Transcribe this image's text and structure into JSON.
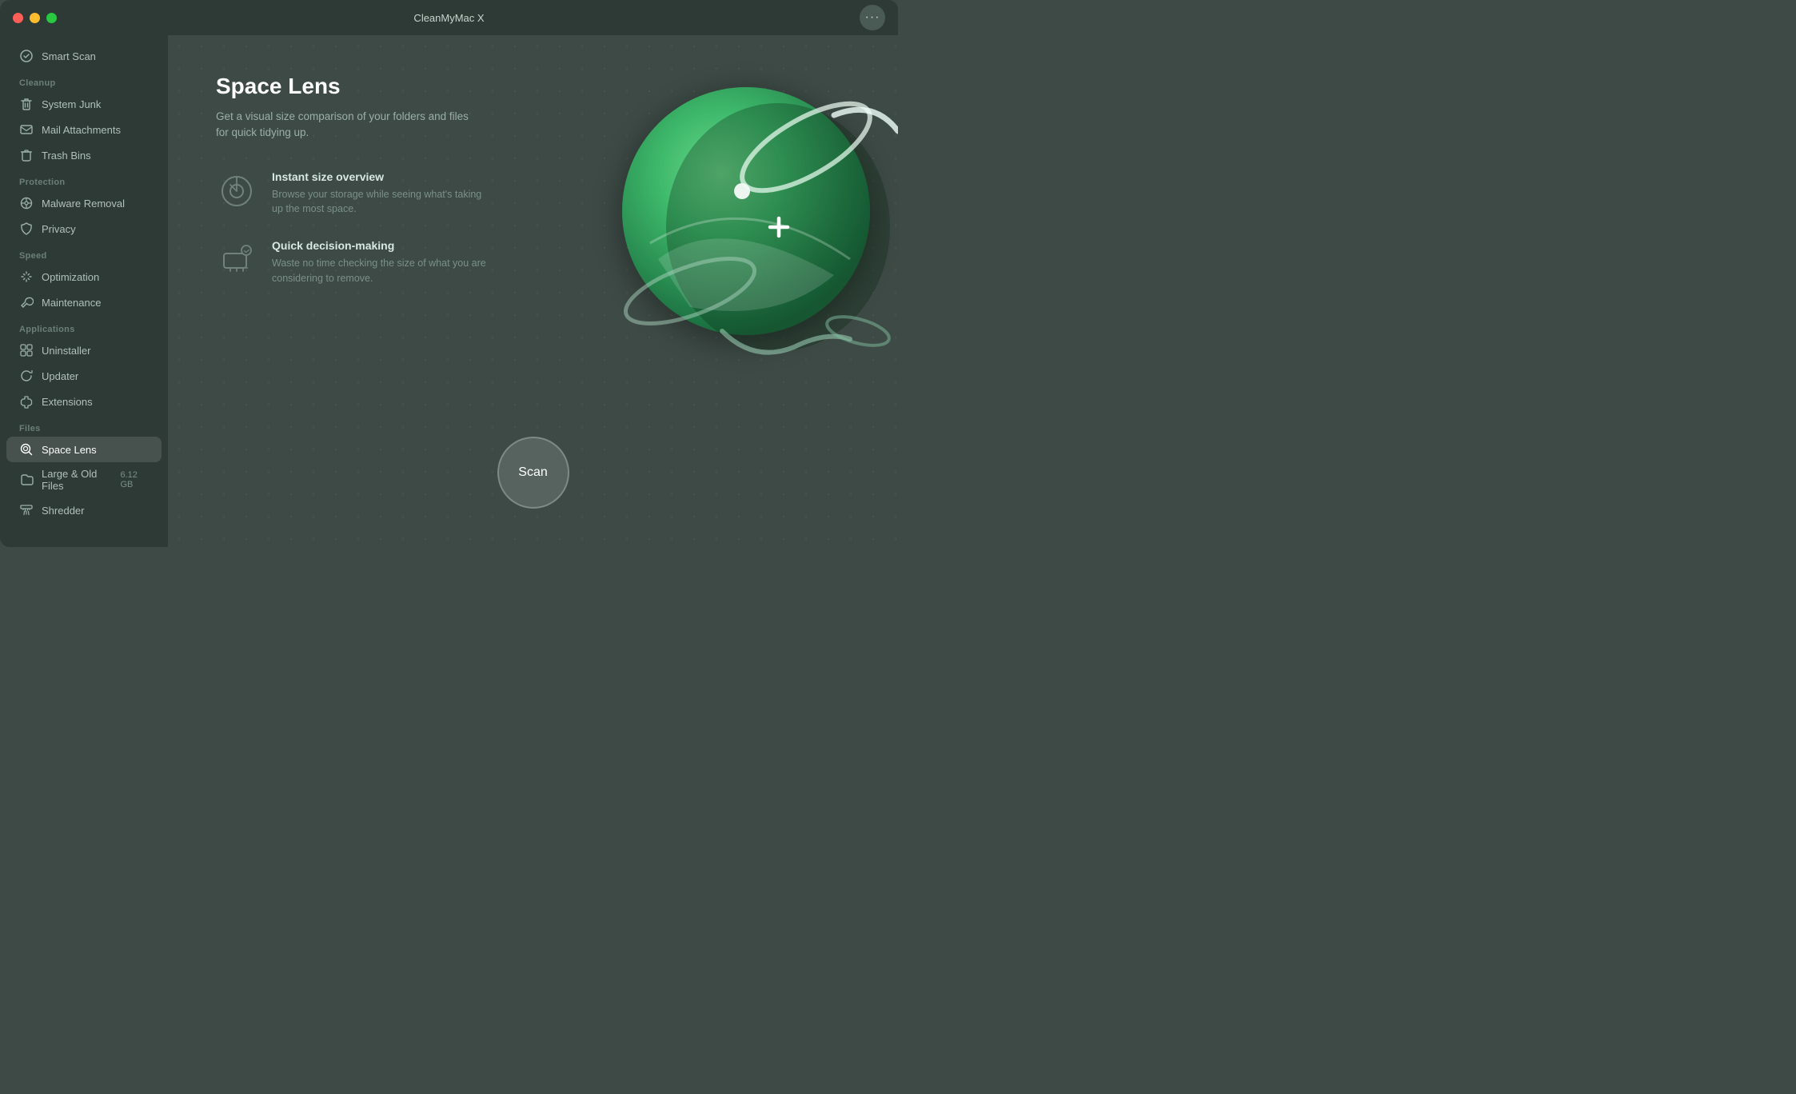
{
  "window": {
    "title": "CleanMyMac X",
    "traffic_lights": {
      "close_label": "close",
      "min_label": "minimize",
      "max_label": "maximize"
    },
    "menu_btn_label": "···"
  },
  "sidebar": {
    "smart_scan_label": "Smart Scan",
    "sections": [
      {
        "label": "Cleanup",
        "items": [
          {
            "id": "system-junk",
            "label": "System Junk",
            "icon": "recycle"
          },
          {
            "id": "mail-attachments",
            "label": "Mail Attachments",
            "icon": "mail"
          },
          {
            "id": "trash-bins",
            "label": "Trash Bins",
            "icon": "trash"
          }
        ]
      },
      {
        "label": "Protection",
        "items": [
          {
            "id": "malware-removal",
            "label": "Malware Removal",
            "icon": "biohazard"
          },
          {
            "id": "privacy",
            "label": "Privacy",
            "icon": "hand"
          }
        ]
      },
      {
        "label": "Speed",
        "items": [
          {
            "id": "optimization",
            "label": "Optimization",
            "icon": "sliders"
          },
          {
            "id": "maintenance",
            "label": "Maintenance",
            "icon": "wrench"
          }
        ]
      },
      {
        "label": "Applications",
        "items": [
          {
            "id": "uninstaller",
            "label": "Uninstaller",
            "icon": "apps"
          },
          {
            "id": "updater",
            "label": "Updater",
            "icon": "refresh"
          },
          {
            "id": "extensions",
            "label": "Extensions",
            "icon": "puzzle"
          }
        ]
      },
      {
        "label": "Files",
        "items": [
          {
            "id": "space-lens",
            "label": "Space Lens",
            "icon": "lens",
            "active": true
          },
          {
            "id": "large-old-files",
            "label": "Large & Old Files",
            "icon": "folder",
            "badge": "6.12 GB"
          },
          {
            "id": "shredder",
            "label": "Shredder",
            "icon": "shredder"
          }
        ]
      }
    ]
  },
  "main": {
    "title": "Space Lens",
    "description": "Get a visual size comparison of your folders and files for quick tidying up.",
    "features": [
      {
        "id": "instant-overview",
        "title": "Instant size overview",
        "description": "Browse your storage while seeing what's taking up the most space."
      },
      {
        "id": "quick-decision",
        "title": "Quick decision-making",
        "description": "Waste no time checking the size of what you are considering to remove."
      }
    ],
    "scan_button_label": "Scan"
  }
}
